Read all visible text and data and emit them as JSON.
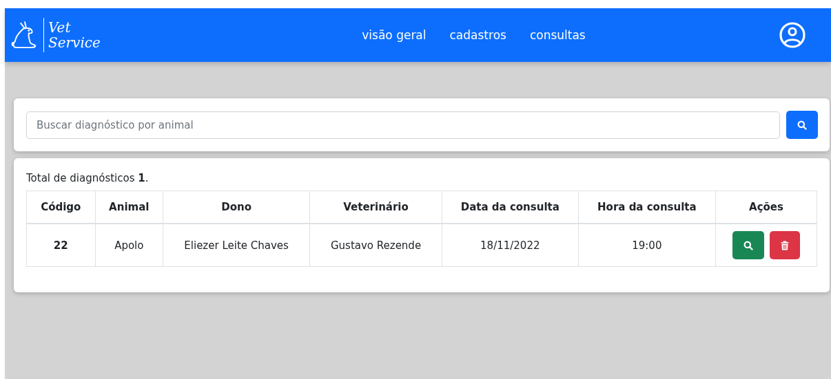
{
  "navbar": {
    "logo": {
      "line_1": "Vet",
      "line_2": "Service"
    },
    "links": [
      {
        "label": "visão geral"
      },
      {
        "label": "cadastros"
      },
      {
        "label": "consultas"
      }
    ]
  },
  "search": {
    "placeholder": "Buscar diagnóstico por animal"
  },
  "summary": "Total de diagnósticos **1**.",
  "table": {
    "columns": [
      "Código",
      "Animal",
      "Dono",
      "Veterinário",
      "Data da consulta",
      "Hora da consulta",
      "Ações"
    ],
    "rows": [
      {
        "cells": [
          "22",
          "Apolo",
          "Eliezer Leite Chaves",
          "Gustavo Rezende",
          "18/11/2022",
          "19:00"
        ],
        "actions": [
          {
            "kind": "view"
          },
          {
            "kind": "delete"
          }
        ]
      }
    ]
  }
}
